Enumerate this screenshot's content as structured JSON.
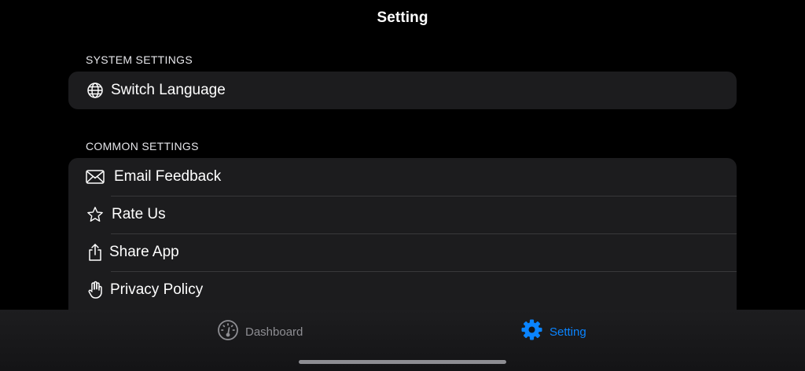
{
  "nav": {
    "title": "Setting"
  },
  "sections": [
    {
      "header": "SYSTEM SETTINGS",
      "items": [
        {
          "label": "Switch Language",
          "icon": "globe-icon"
        }
      ]
    },
    {
      "header": "COMMON SETTINGS",
      "items": [
        {
          "label": "Email Feedback",
          "icon": "envelope-icon"
        },
        {
          "label": "Rate Us",
          "icon": "star-icon"
        },
        {
          "label": "Share App",
          "icon": "share-icon"
        },
        {
          "label": "Privacy Policy",
          "icon": "hand-icon"
        }
      ]
    }
  ],
  "tabbar": {
    "tabs": [
      {
        "label": "Dashboard",
        "icon": "gauge-icon",
        "selected": false
      },
      {
        "label": "Setting",
        "icon": "gear-icon",
        "selected": true
      }
    ]
  },
  "colors": {
    "background": "#000000",
    "group": "#1c1c1e",
    "accent": "#0a84ff",
    "inactive": "#8e8e93"
  }
}
